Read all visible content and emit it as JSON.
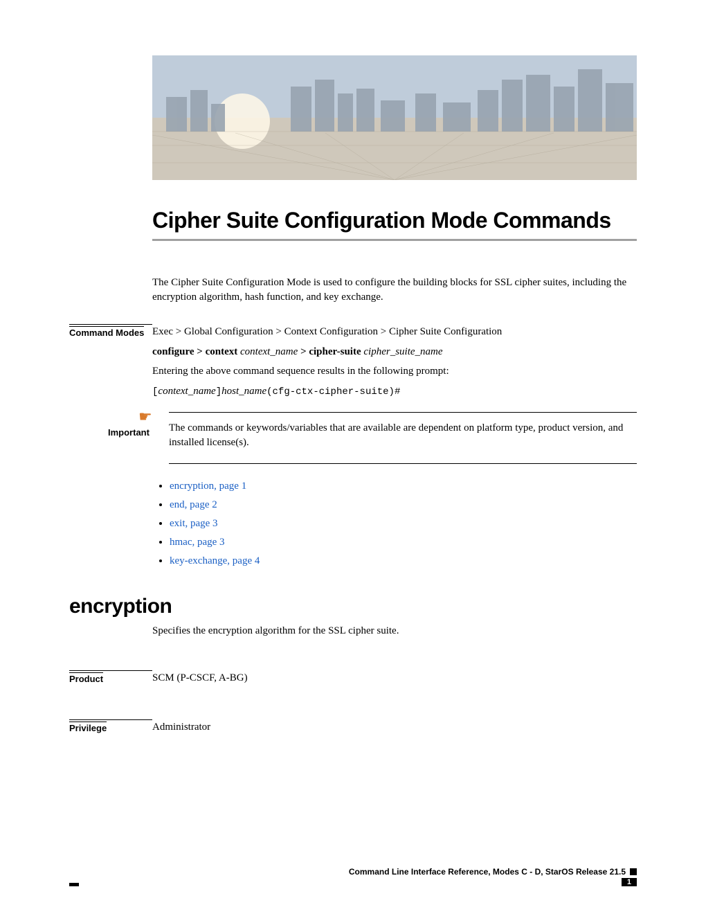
{
  "title": "Cipher Suite Configuration Mode Commands",
  "intro": "The Cipher Suite Configuration Mode is used to configure the building blocks for SSL cipher suites, including the encryption algorithm, hash function, and key exchange.",
  "command_modes": {
    "label": "Command Modes",
    "path": "Exec > Global Configuration > Context Configuration > Cipher Suite Configuration",
    "syntax_prefix": "configure > context ",
    "syntax_var1": "context_name",
    "syntax_mid": " > cipher-suite ",
    "syntax_var2": "cipher_suite_name",
    "entering": "Entering the above command sequence results in the following prompt:",
    "prompt_open": "[",
    "prompt_ctx": "context_name",
    "prompt_close": "]",
    "prompt_host": "host_name",
    "prompt_tail": "(cfg-ctx-cipher-suite)#"
  },
  "important": {
    "label": "Important",
    "text": "The commands or keywords/variables that are available are dependent on platform type, product version, and installed license(s)."
  },
  "toc": [
    "encryption,  page  1",
    "end,  page  2",
    "exit,  page  3",
    "hmac,  page  3",
    "key-exchange,  page  4"
  ],
  "encryption": {
    "heading": "encryption",
    "desc": "Specifies the encryption algorithm for the SSL cipher suite.",
    "product_label": "Product",
    "product_value": "SCM (P-CSCF, A-BG)",
    "privilege_label": "Privilege",
    "privilege_value": "Administrator"
  },
  "footer": {
    "ref": "Command Line Interface Reference, Modes C - D, StarOS Release 21.5",
    "page": "1"
  }
}
